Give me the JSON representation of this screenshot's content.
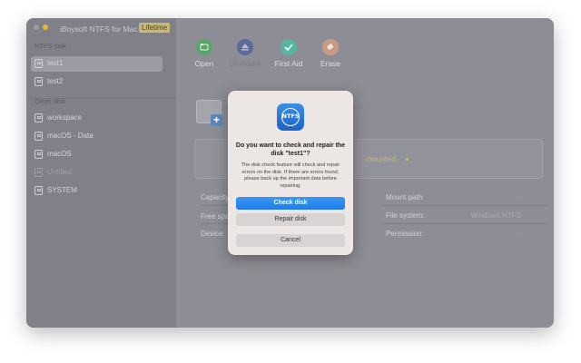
{
  "app": {
    "title": "iBoysoft NTFS for Mac",
    "badge": "Lifetime"
  },
  "sidebar": {
    "ntfs_section": "NTFS disk",
    "other_section": "Other disk",
    "ntfs_items": [
      {
        "label": "test1",
        "selected": true
      },
      {
        "label": "test2",
        "selected": false
      }
    ],
    "other_items": [
      {
        "label": "workspace",
        "dim": false
      },
      {
        "label": "macOS - Data",
        "dim": false
      },
      {
        "label": "macOS",
        "dim": false
      },
      {
        "label": "Untitled",
        "dim": true
      },
      {
        "label": "SYSTEM",
        "dim": false
      }
    ]
  },
  "toolbar": {
    "open": "Open",
    "unmount": "Unmount",
    "first_aid": "First Aid",
    "erase": "Erase"
  },
  "status": {
    "text": "mounted"
  },
  "info": {
    "capacity_label": "Capacity:",
    "free_space_label": "Free spa",
    "device_label": "Device:",
    "mount_path_label": "Mount path:",
    "mount_path_value": "-",
    "file_system_label": "File system:",
    "file_system_value": "Windows NTFS",
    "permission_label": "Permission:",
    "permission_value": "-"
  },
  "dialog": {
    "logo_text": "NTFS",
    "title": "Do you want to check and repair the disk \"test1\"?",
    "body": "The disk check feature will check and repair errors on the disk. If there are errors found, please back up the important data before repairing.",
    "check_button": "Check disk",
    "repair_button": "Repair disk",
    "cancel_button": "Cancel"
  },
  "colors": {
    "accent": "#1f7be8",
    "lifetime_badge": "#c9b877",
    "overlay": "#8d8e95"
  }
}
